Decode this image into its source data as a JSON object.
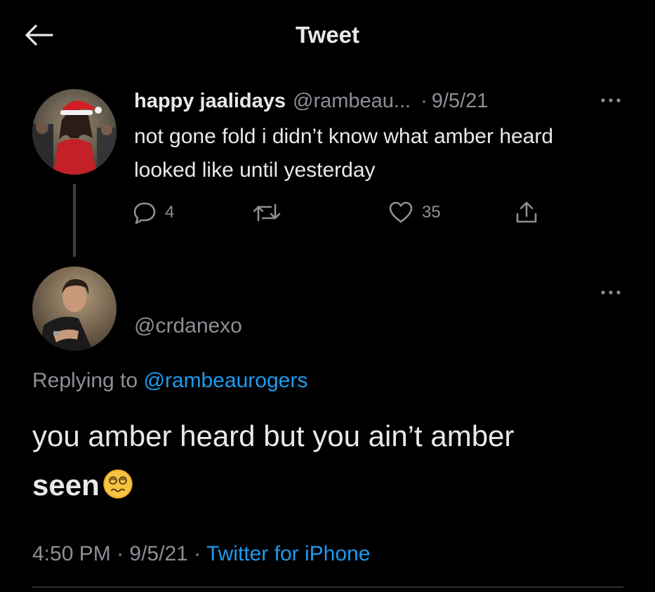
{
  "header": {
    "title": "Tweet",
    "back_icon": "arrow-left-icon"
  },
  "parent_tweet": {
    "display_name": "happy jaalidays",
    "handle": "@rambeau...",
    "dot": "·",
    "date": "9/5/21",
    "text": "not gone fold i didn’t know what amber heard looked like until yesterday",
    "reply_count": "4",
    "retweet_count": "",
    "like_count": "35"
  },
  "reply_tweet": {
    "handle": "@crdanexo",
    "replying_prefix": "Replying to",
    "replying_handle": "@rambeaurogers",
    "text_main": "you amber heard but you ain’t amber",
    "text_bold": "seen",
    "emoji": "dizzy-face-emoji"
  },
  "meta": {
    "time": "4:50 PM",
    "sep1": " · ",
    "date": "9/5/21",
    "sep2": " · ",
    "source": "Twitter for iPhone"
  },
  "colors": {
    "background": "#000000",
    "text": "#e7e9ea",
    "muted": "#8b9096",
    "link": "#1d9bf0",
    "divider": "#2f3336"
  }
}
